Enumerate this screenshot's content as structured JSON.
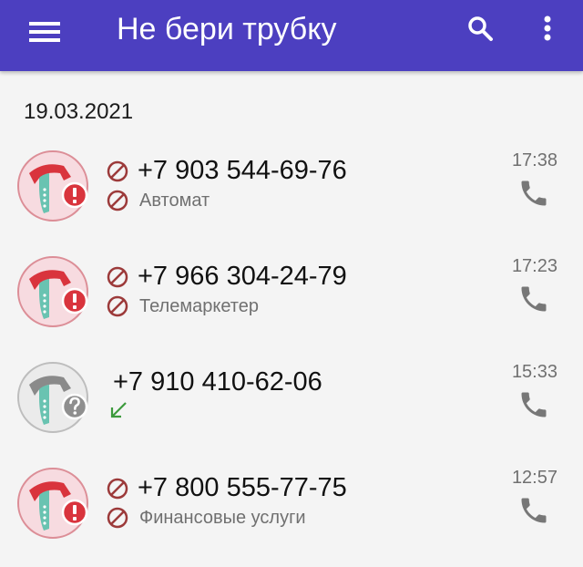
{
  "app_bar": {
    "title": "Не бери трубку",
    "menu_icon": "hamburger-menu-icon",
    "search_icon": "search-icon",
    "more_icon": "more-vert-icon",
    "background": "#4c3fc0"
  },
  "date_header": "19.03.2021",
  "calls": [
    {
      "number": "+7 903 544-69-76",
      "label": "Автомат",
      "time": "17:38",
      "status": "blocked"
    },
    {
      "number": "+7 966 304-24-79",
      "label": "Телемаркетер",
      "time": "17:23",
      "status": "blocked"
    },
    {
      "number": "+7 910 410-62-06",
      "label": "",
      "time": "15:33",
      "status": "unknown"
    },
    {
      "number": "+7 800 555-77-75",
      "label": "Финансовые услуги",
      "time": "12:57",
      "status": "blocked"
    }
  ],
  "colors": {
    "accent": "#4c3fc0",
    "blocked_red": "#9c3a3a",
    "badge_red": "#d9343d",
    "teal": "#69c3b1",
    "incoming_green": "#3c9a3c"
  }
}
